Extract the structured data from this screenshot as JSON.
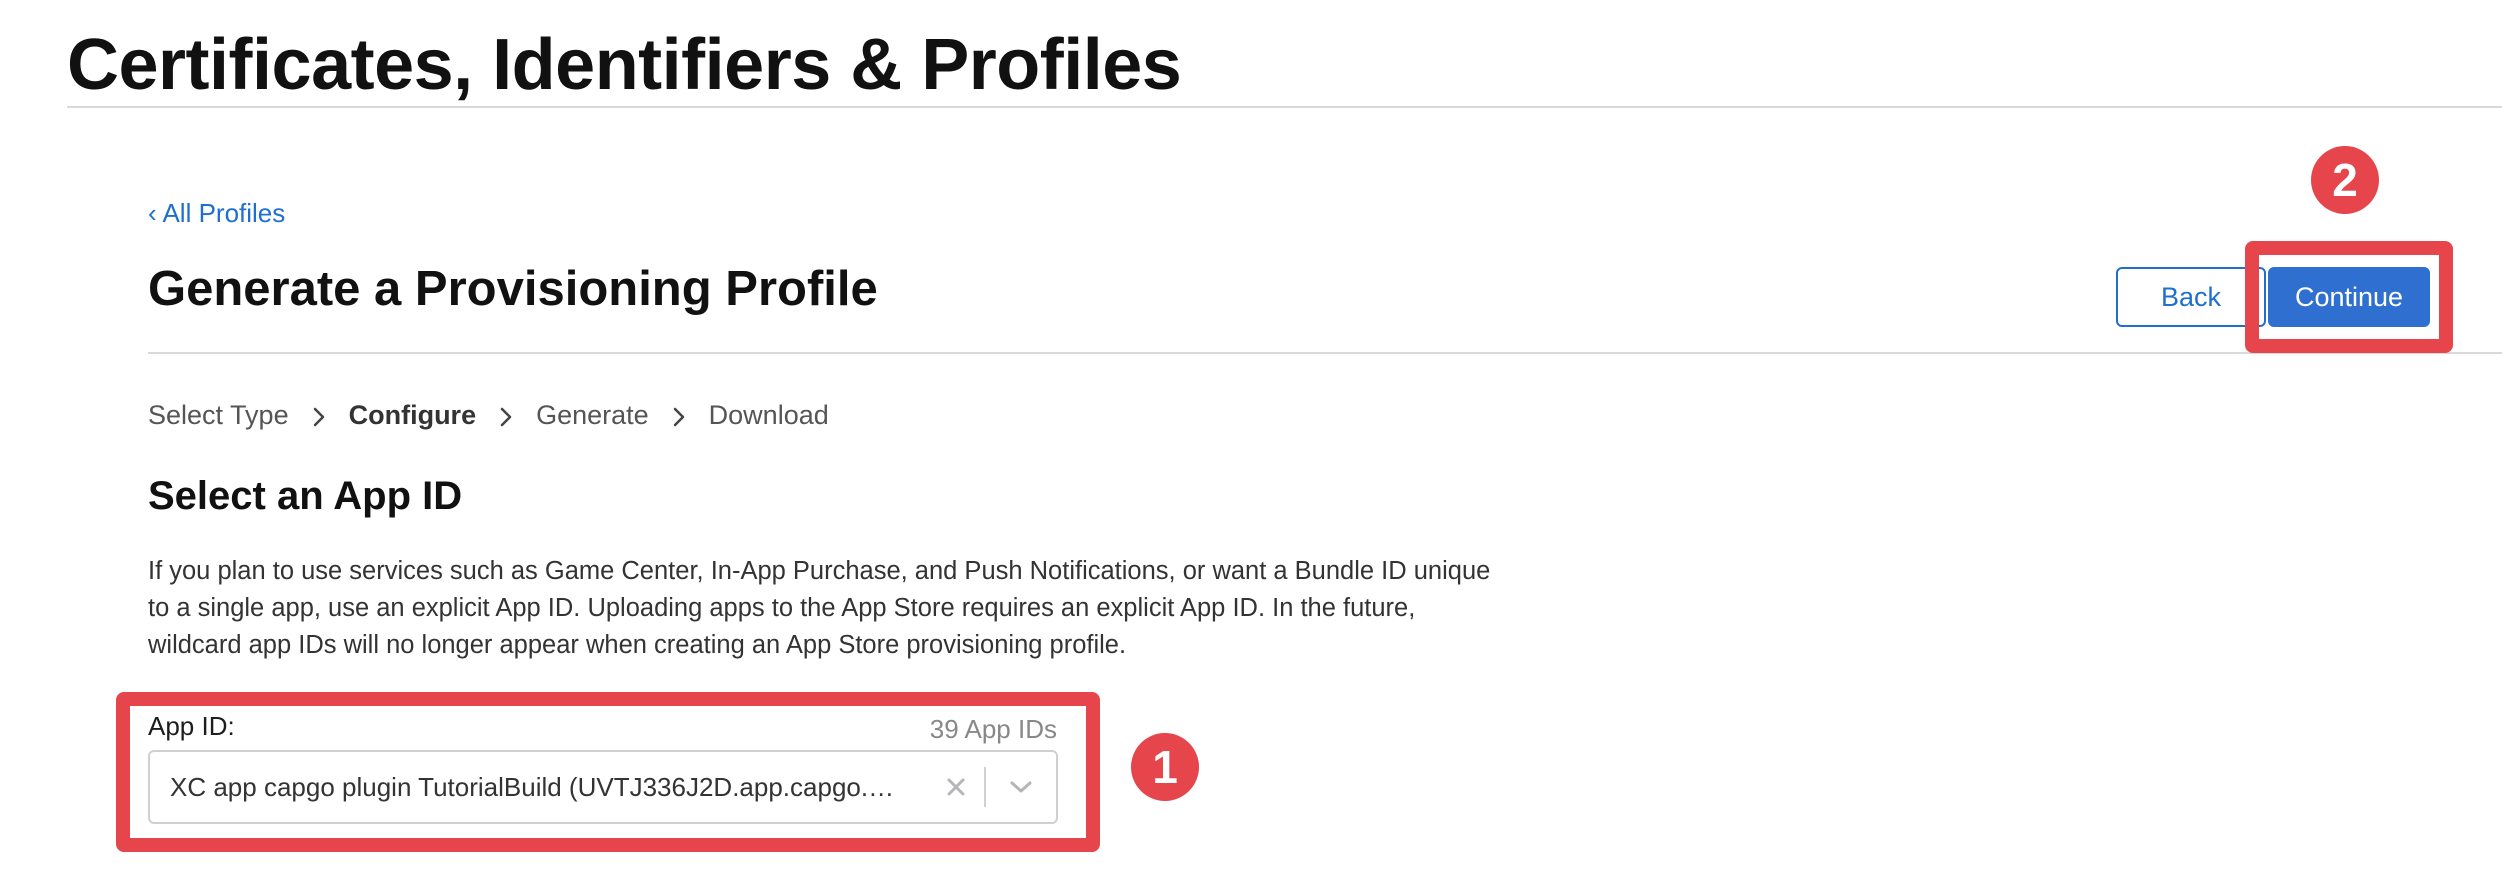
{
  "header": {
    "site_title": "Certificates, Identifiers & Profiles"
  },
  "nav": {
    "back_link": "‹ All Profiles"
  },
  "section": {
    "title": "Generate a Provisioning Profile"
  },
  "actions": {
    "back_label": "Back",
    "continue_label": "Continue"
  },
  "steps": [
    {
      "label": "Select Type",
      "active": false
    },
    {
      "label": "Configure",
      "active": true
    },
    {
      "label": "Generate",
      "active": false
    },
    {
      "label": "Download",
      "active": false
    }
  ],
  "app_id_section": {
    "title": "Select an App ID",
    "description_lines": [
      "If you plan to use services such as Game Center, In-App Purchase, and Push Notifications, or want a Bundle ID unique",
      "to a single app, use an explicit App ID. Uploading apps to the App Store requires an explicit App ID. In the future,",
      "wildcard app IDs will no longer appear when creating an App Store provisioning profile."
    ],
    "field_label": "App ID:",
    "count_label": "39 App IDs",
    "selected_value": "XC app capgo plugin TutorialBuild (UVTJ336J2D.app.capgo.…"
  },
  "annotations": {
    "badge_1": "1",
    "badge_2": "2",
    "highlight_color": "#e5454b"
  },
  "colors": {
    "accent": "#2f6fd0",
    "link": "#1f6fd1"
  },
  "icons": {
    "clear": "close-icon",
    "dropdown": "chevron-down-icon",
    "step_separator": "chevron-right-icon"
  }
}
